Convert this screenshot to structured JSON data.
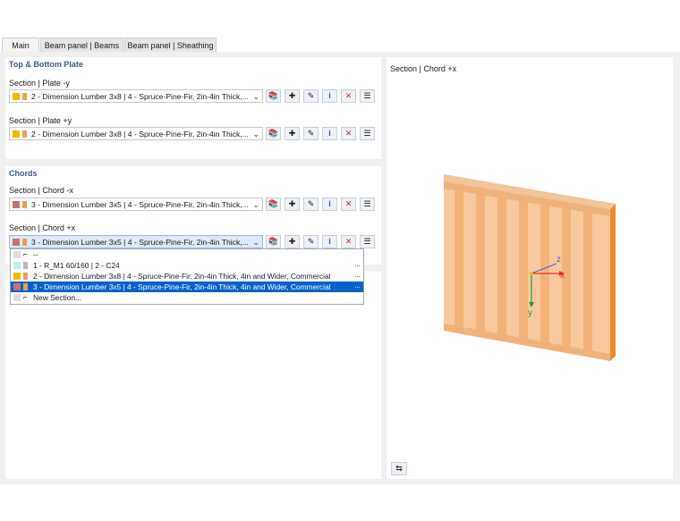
{
  "tabs": [
    {
      "label": "Main"
    },
    {
      "label": "Beam panel | Beams"
    },
    {
      "label": "Beam panel | Sheathing"
    }
  ],
  "top_bottom": {
    "title": "Top & Bottom Plate",
    "plate_minus_y": {
      "label": "Section | Plate -y",
      "value": "2 - Dimension Lumber 3x8 | 4 - Spruce-Pine-Fir, 2in-4in Thick,..."
    },
    "plate_plus_y": {
      "label": "Section | Plate +y",
      "value": "2 - Dimension Lumber 3x8 | 4 - Spruce-Pine-Fir, 2in-4in Thick,..."
    }
  },
  "chords": {
    "title": "Chords",
    "chord_minus_x": {
      "label": "Section | Chord -x",
      "value": "3 - Dimension Lumber 3x5 | 4 - Spruce-Pine-Fir, 2in-4in Thick,..."
    },
    "chord_plus_x": {
      "label": "Section | Chord +x",
      "value": "3 - Dimension Lumber 3x5 | 4 - Spruce-Pine-Fir, 2in-4in Thick,..."
    }
  },
  "dropdown": {
    "items": [
      {
        "label": "--",
        "more": ""
      },
      {
        "label": "1 - R_M1 60/160 | 2 - C24",
        "more": "..."
      },
      {
        "label": "2 - Dimension Lumber 3x8 | 4 - Spruce-Pine-Fir, 2in-4in Thick, 4in and Wider, Commercial",
        "more": "..."
      },
      {
        "label": "3 - Dimension Lumber 3x5 | 4 - Spruce-Pine-Fir, 2in-4in Thick, 4in and Wider, Commercial",
        "more": "..."
      },
      {
        "label": "New Section...",
        "more": ""
      }
    ]
  },
  "preview": {
    "title": "Section | Chord +x",
    "axes": {
      "x": "x",
      "y": "y",
      "z": "z"
    }
  },
  "colors": {
    "plate_color": "#f5b800",
    "chord_color": "#c87070",
    "wood_color": "#e8a050",
    "axis_x": "#e23030",
    "axis_y": "#2a9a2a",
    "axis_z": "#5560d8",
    "selection": "#0a62c8"
  },
  "icons": [
    "library-icon",
    "new-section-icon",
    "edit-section-icon",
    "info-icon",
    "delete-section-icon",
    "list-icon"
  ]
}
